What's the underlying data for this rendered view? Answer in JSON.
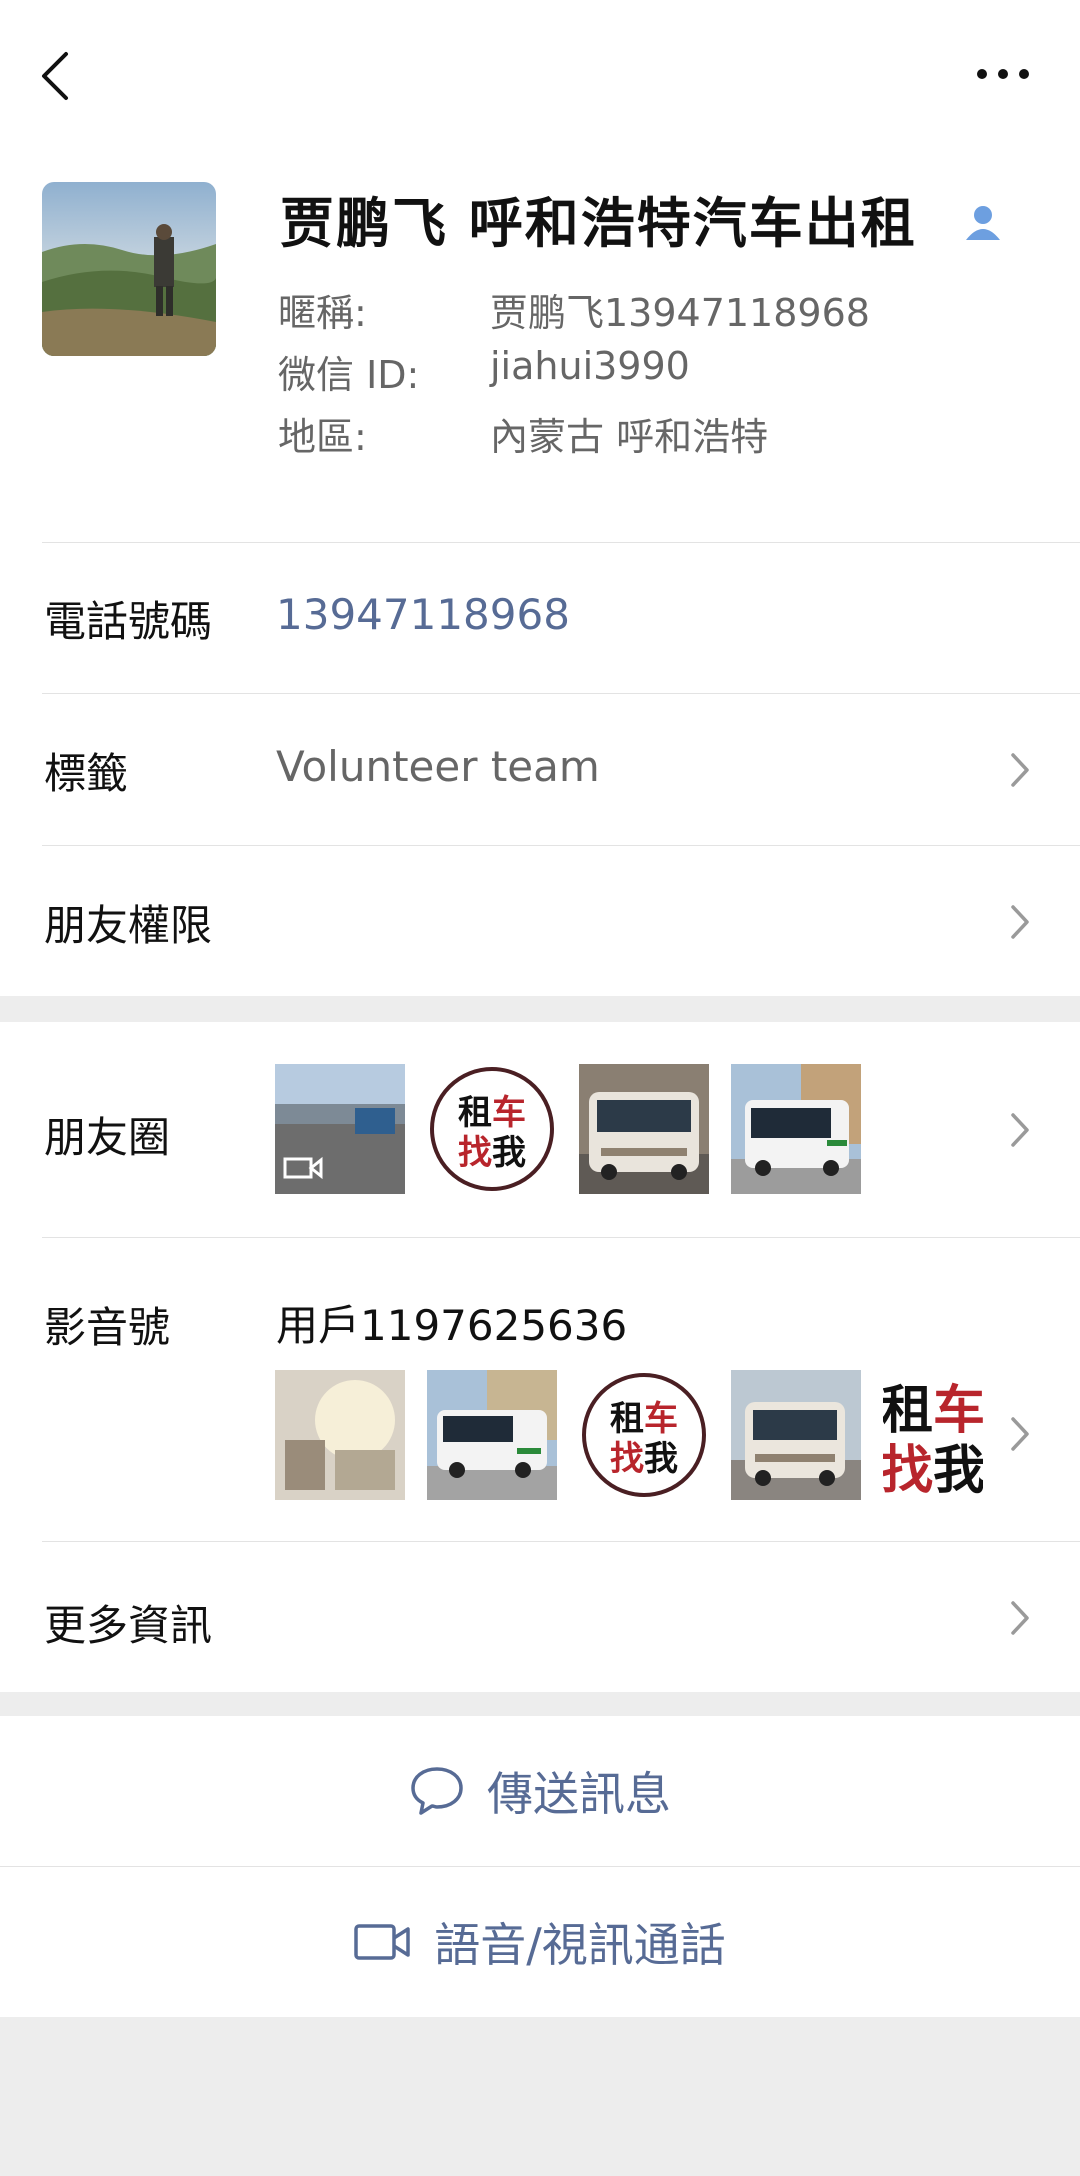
{
  "topbar": {
    "back_icon": "chevron-left-icon",
    "more_icon": "more-dots-icon"
  },
  "profile": {
    "name": "贾鹏飞 呼和浩特汽车出租",
    "contact_icon": "person-icon",
    "nickname_label": "暱稱:",
    "nickname": "贾鹏飞13947118968",
    "wechat_id_label": "微信 ID:",
    "wechat_id": "jiahui3990",
    "region_label": "地區:",
    "region": "內蒙古  呼和浩特"
  },
  "rows": {
    "phone_label": "電話號碼",
    "phone": "13947118968",
    "tags_label": "標籤",
    "tags_value": "Volunteer team",
    "permissions_label": "朋友權限",
    "moments_label": "朋友圈",
    "channels_label": "影音號",
    "channels_user": "用戶1197625636",
    "more_info_label": "更多資訊"
  },
  "moments_thumbs": [
    {
      "text": "",
      "kind": "video"
    },
    {
      "text_top": "租车",
      "text_bottom": "找我",
      "kind": "logo"
    },
    {
      "text": "",
      "kind": "bus"
    },
    {
      "text": "",
      "kind": "bus2"
    }
  ],
  "channels_thumbs": [
    {
      "kind": "photo"
    },
    {
      "kind": "bus2"
    },
    {
      "text_top": "租车",
      "text_bottom": "找我",
      "kind": "logo"
    },
    {
      "kind": "bus"
    },
    {
      "text_top": "租车",
      "text_bottom": "找我",
      "kind": "logo-crop"
    }
  ],
  "actions": {
    "send_message": "傳送訊息",
    "message_icon": "chat-bubble-icon",
    "call": "語音/視訊通話",
    "call_icon": "video-camera-icon"
  },
  "colors": {
    "link": "#576b95",
    "accent_red": "#b8252c"
  }
}
